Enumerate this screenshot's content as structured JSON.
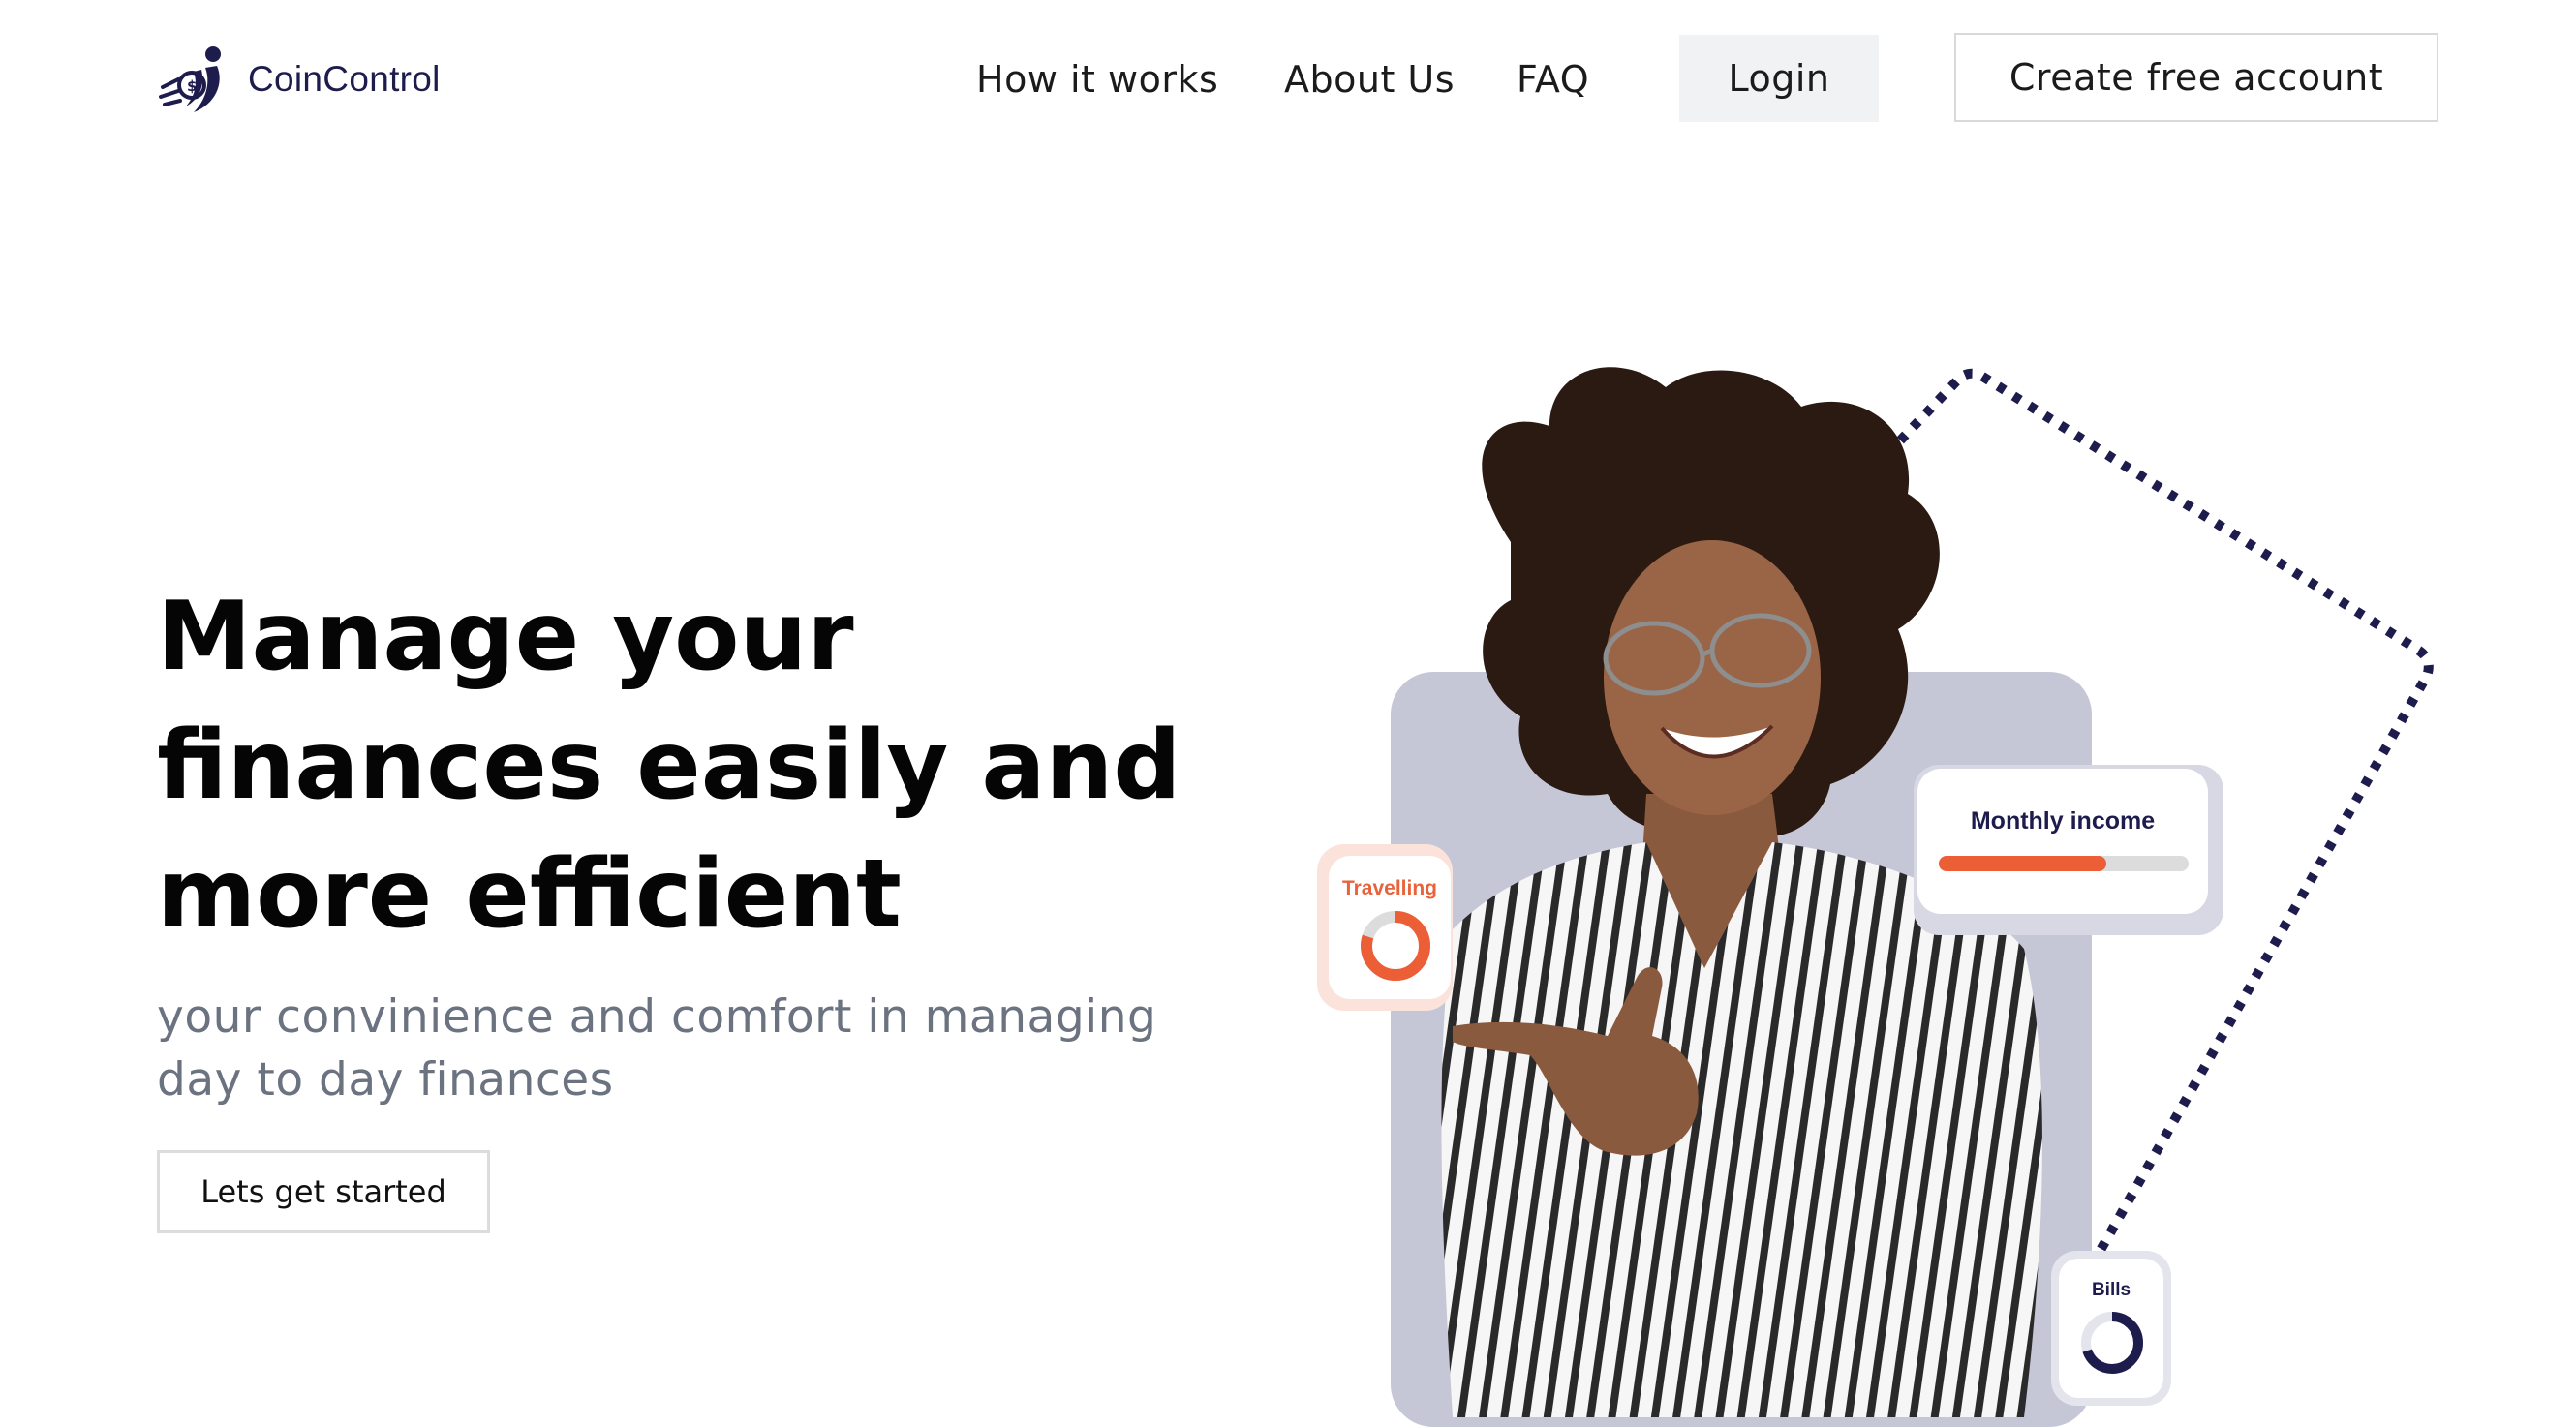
{
  "brand": {
    "name": "CoinControl",
    "logo_icon": "coin-person-icon",
    "color": "#1d1c4d"
  },
  "nav": {
    "links": [
      "How it works",
      "About Us",
      "FAQ"
    ],
    "login_label": "Login",
    "create_label": "Create free account"
  },
  "hero": {
    "title_lines": [
      "Manage your",
      "finances easily and",
      "more efficient"
    ],
    "subtitle_lines": [
      "your convinience and comfort in managing",
      "day to day finances"
    ],
    "cta_label": "Lets get started"
  },
  "cards": {
    "monthly_income": {
      "label": "Monthly income",
      "progress": 0.67
    },
    "travelling": {
      "label": "Travelling",
      "progress": 0.8
    },
    "bills": {
      "label": "Bills",
      "progress": 0.7
    }
  },
  "colors": {
    "accent": "#ec5e36",
    "navy": "#1d1c4d",
    "muted": "#6b7280",
    "photo_bg": "#c5c6d6"
  }
}
